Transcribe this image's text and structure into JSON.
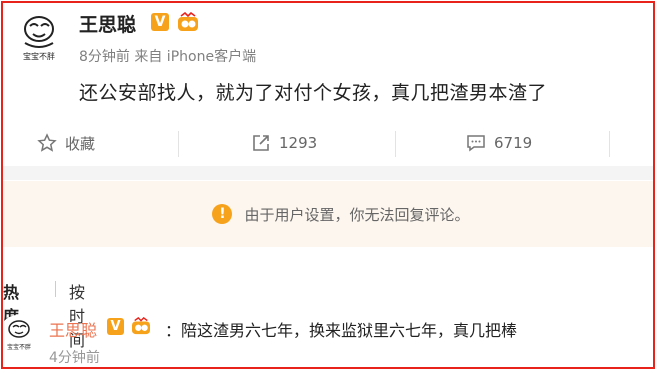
{
  "post": {
    "username": "王思聪",
    "verified_badge": "V",
    "meta": "8分钟前 来自 iPhone客户端",
    "content": "还公安部找人，就为了对付个女孩，真几把渣男本渣了",
    "avatar_caption": "宝宝不胖"
  },
  "actions": {
    "favorite_label": "收藏",
    "repost_count": "1293",
    "comment_count": "6719"
  },
  "notice": {
    "icon": "!",
    "text": "由于用户设置，你无法回复评论。"
  },
  "tabs": {
    "hot": "热度",
    "time": "按时间"
  },
  "comment": {
    "username": "王思聪",
    "verified_badge": "V",
    "text": "：陪这渣男六七年，换来监狱里六七年，真几把棒",
    "time": "4分钟前",
    "avatar_caption": "宝宝不胖"
  },
  "colors": {
    "frame": "#e8231c",
    "badge": "#f7a21b",
    "comment_user": "#eb7350"
  }
}
